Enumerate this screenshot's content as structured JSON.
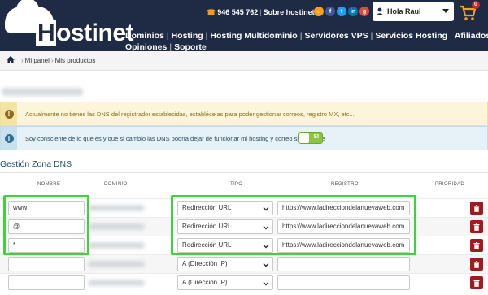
{
  "header": {
    "logo_text": "ostinet",
    "logo_initial": "H",
    "phone": "946 545 762",
    "about_link": "Sobre hostinet",
    "user_greeting": "Hola Raul",
    "cart_count": "0",
    "nav": [
      "Dominios",
      "Hosting",
      "Hosting Multidominio",
      "Servidores VPS",
      "Servicios Hosting",
      "Afiliados",
      "Opiniones",
      "Soporte"
    ]
  },
  "breadcrumb": [
    "Mi panel",
    "Mis productos"
  ],
  "alerts": {
    "warning": "Actualmente no tienes las DNS del registrador establecidas, establécelas para poder gestionar correos, registro MX, etc...",
    "info": "Soy consciente de lo que es y que si cambio las DNS podría dejar de funcionar mi hosting y correo si lo tuviere",
    "toggle_label": "SI"
  },
  "section_title": "Gestión Zona DNS",
  "table": {
    "headers": [
      "NOMBRE",
      "DOMINIO",
      "TIPO",
      "REGISTRO",
      "PRIORIDAD"
    ],
    "rows": [
      {
        "nombre": "www",
        "tipo": "Redirección URL",
        "registro": "https://www.ladirecciondelanuevaweb.com"
      },
      {
        "nombre": "@",
        "tipo": "Redirección URL",
        "registro": "https://www.ladirecciondelanuevaweb.com"
      },
      {
        "nombre": "*",
        "tipo": "Redirección URL",
        "registro": "https://www.ladirecciondelanuevaweb.com"
      },
      {
        "nombre": "",
        "tipo": "A (Dirección IP)",
        "registro": ""
      },
      {
        "nombre": "",
        "tipo": "A (Dirección IP)",
        "registro": ""
      }
    ]
  },
  "colors": {
    "header_bg": "#1f2a44",
    "accent_orange": "#f6a01a",
    "highlight_green": "#3bd53b",
    "delete_red": "#a3191d",
    "toggle_green": "#8cc63f"
  },
  "icons": [
    "phone-icon",
    "user-icon",
    "cart-icon",
    "home-icon",
    "warning-icon",
    "info-icon",
    "chevron-down-icon",
    "trash-icon"
  ]
}
